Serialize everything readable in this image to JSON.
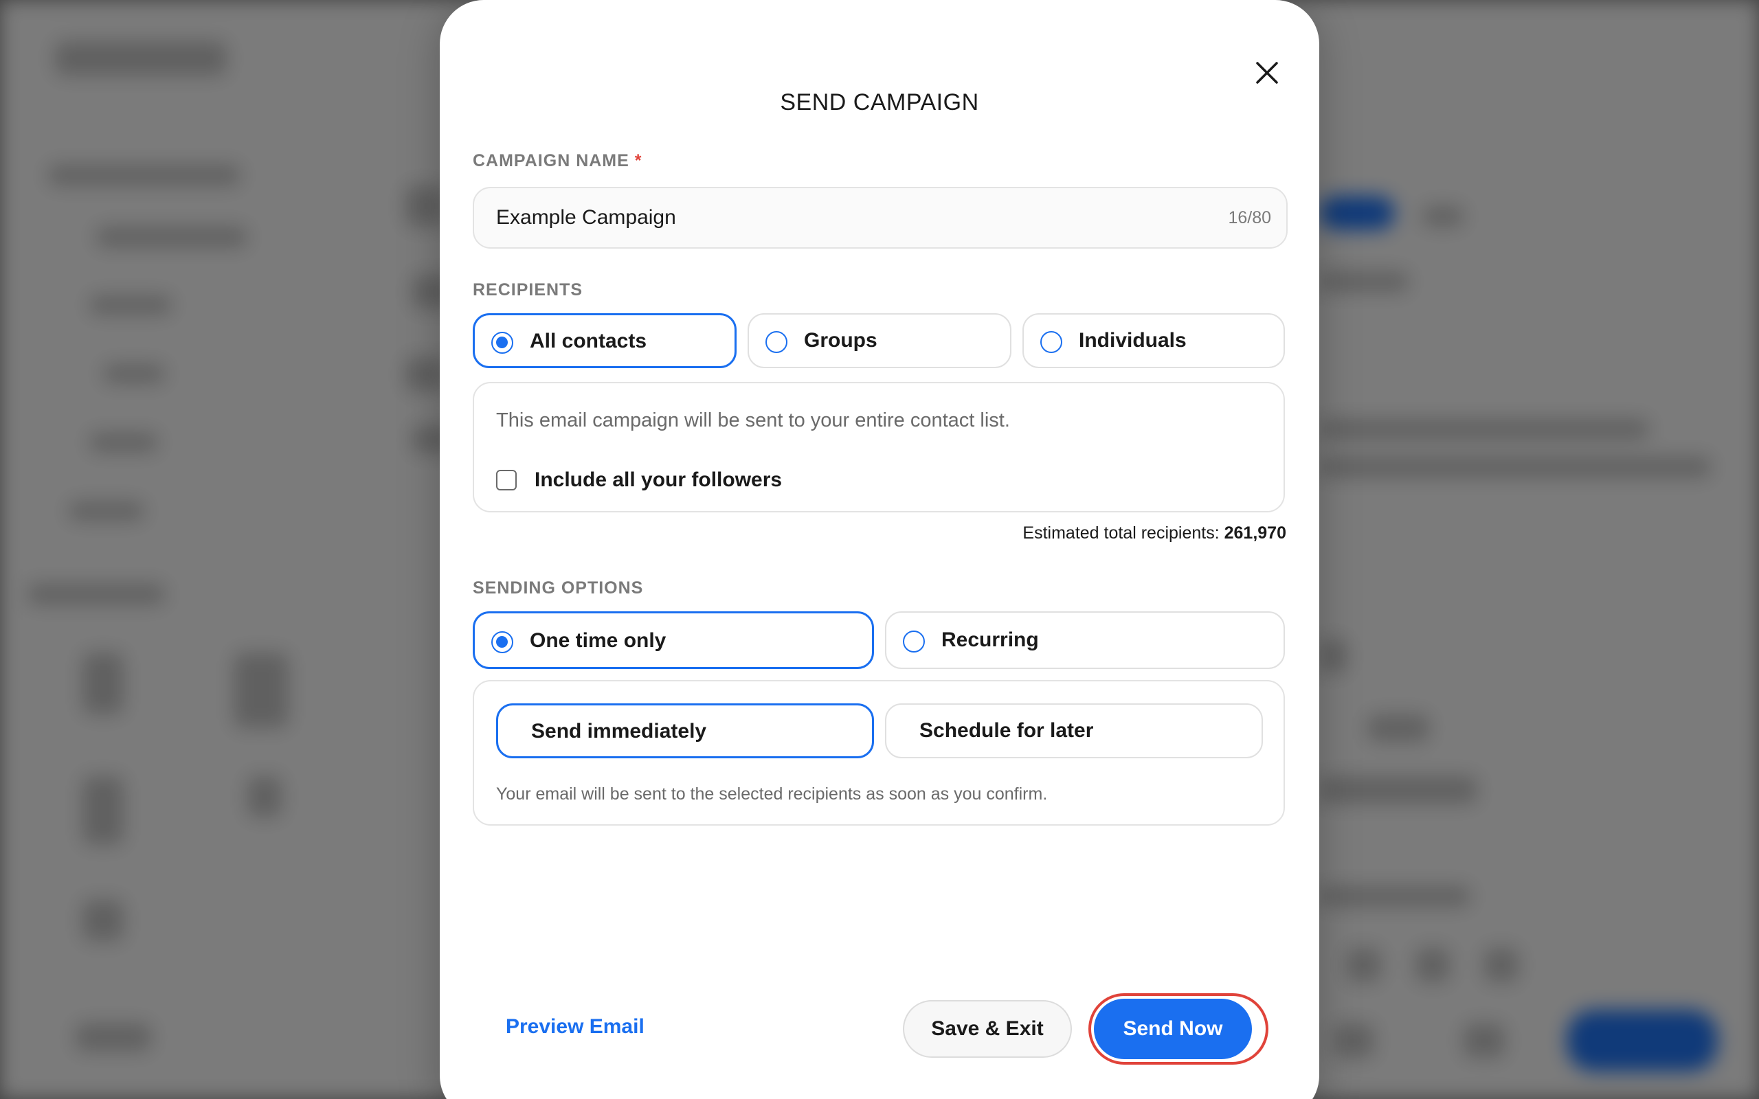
{
  "modal": {
    "title": "SEND CAMPAIGN",
    "close_icon": "close-icon"
  },
  "campaign_name": {
    "label": "CAMPAIGN NAME",
    "required_marker": "*",
    "value": "Example Campaign",
    "char_count": "16/80"
  },
  "recipients": {
    "label": "RECIPIENTS",
    "options": [
      {
        "label": "All contacts",
        "selected": true
      },
      {
        "label": "Groups",
        "selected": false
      },
      {
        "label": "Individuals",
        "selected": false
      }
    ],
    "description": "This email campaign will be sent to your entire contact list.",
    "include_followers_label": "Include all your followers",
    "include_followers_checked": false,
    "estimate_label": "Estimated total recipients:",
    "estimate_value": "261,970"
  },
  "sending_options": {
    "label": "SENDING OPTIONS",
    "frequency": [
      {
        "label": "One time only",
        "selected": true
      },
      {
        "label": "Recurring",
        "selected": false
      }
    ],
    "timing": [
      {
        "label": "Send immediately",
        "selected": true
      },
      {
        "label": "Schedule for later",
        "selected": false
      }
    ],
    "helper": "Your email will be sent to the selected recipients as soon as you confirm."
  },
  "footer": {
    "preview_label": "Preview Email",
    "save_exit_label": "Save & Exit",
    "send_now_label": "Send Now"
  },
  "colors": {
    "accent": "#1a6ff0",
    "focus_ring": "#e0433a",
    "overlay": "#7d7d7d"
  }
}
